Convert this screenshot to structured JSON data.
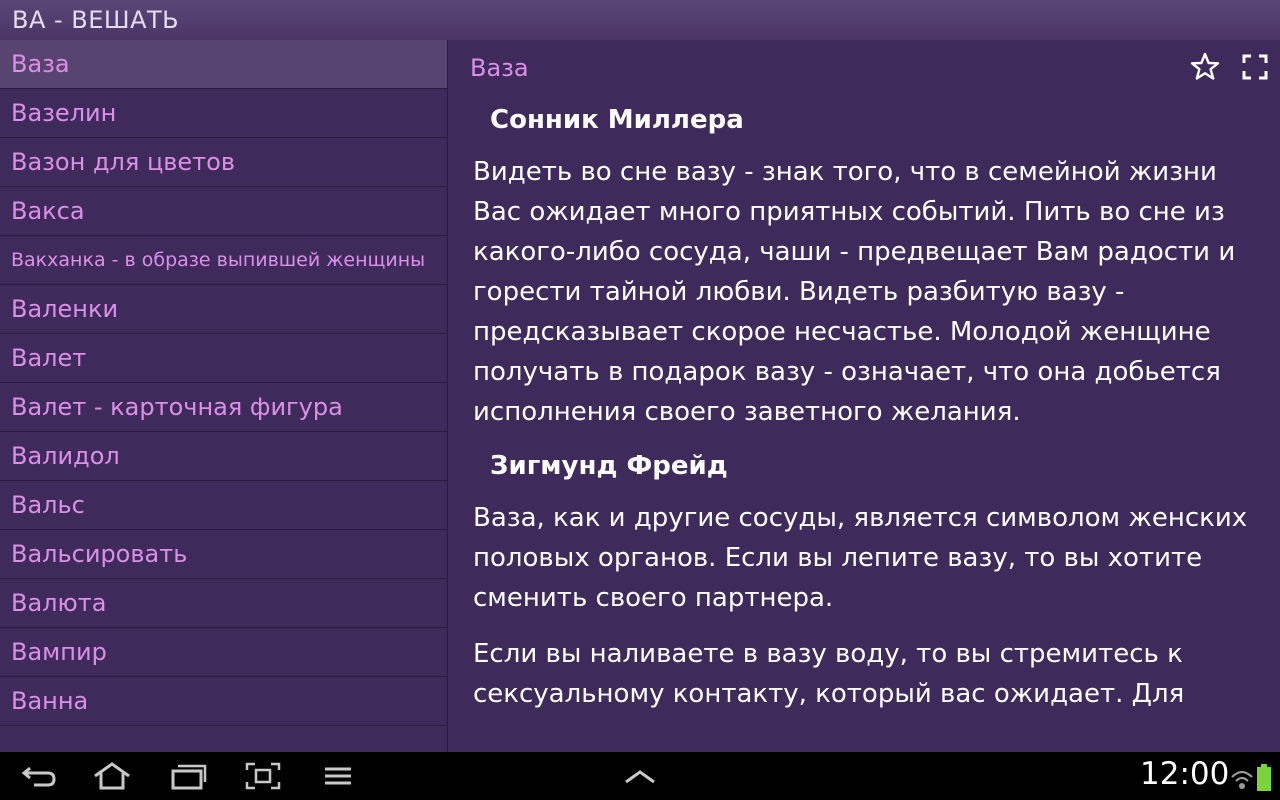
{
  "app": {
    "title": "ВА - ВЕШАТЬ"
  },
  "sidebar": {
    "selected_index": 0,
    "items": [
      {
        "label": "Ваза"
      },
      {
        "label": "Вазелин"
      },
      {
        "label": "Вазон для цветов"
      },
      {
        "label": "Вакса"
      },
      {
        "label": "Вакханка - в образе выпившей женщины"
      },
      {
        "label": "Валенки"
      },
      {
        "label": "Валет"
      },
      {
        "label": "Валет - карточная фигура"
      },
      {
        "label": "Валидол"
      },
      {
        "label": "Вальс"
      },
      {
        "label": "Вальсировать"
      },
      {
        "label": "Валюта"
      },
      {
        "label": "Вампир"
      },
      {
        "label": "Ванна"
      }
    ]
  },
  "content": {
    "title": "Ваза",
    "favorite_icon": "star-outline-icon",
    "fullscreen_icon": "fullscreen-icon",
    "sections": [
      {
        "heading": "Сонник Миллера",
        "paragraphs": [
          "Видеть во сне вазу - знак того, что в семейной жизни Вас ожидает много приятных событий. Пить во сне из какого-либо сосуда, чаши - предвещает Вам радости и горести тайной любви. Видеть разбитую вазу - предсказывает скорое несчастье. Молодой женщине получать в подарок вазу - означает, что она добьется исполнения своего заветного желания."
        ]
      },
      {
        "heading": "Зигмунд Фрейд",
        "paragraphs": [
          "Ваза, как и другие сосуды, является символом женских половых органов. Если вы лепите вазу, то вы хотите сменить своего партнера.",
          "Если вы наливаете в вазу воду, то вы стремитесь к сексуальному контакту, который вас ожидает. Для"
        ]
      }
    ]
  },
  "navbar": {
    "icons": [
      "back-icon",
      "home-icon",
      "recent-apps-icon",
      "screenshot-icon",
      "menu-icon",
      "chevron-up-icon",
      "wifi-icon",
      "battery-icon"
    ],
    "time": "12:00"
  },
  "colors": {
    "background": "#3f2a5c",
    "accent_text": "#dc8fe6",
    "selected": "#574471"
  }
}
